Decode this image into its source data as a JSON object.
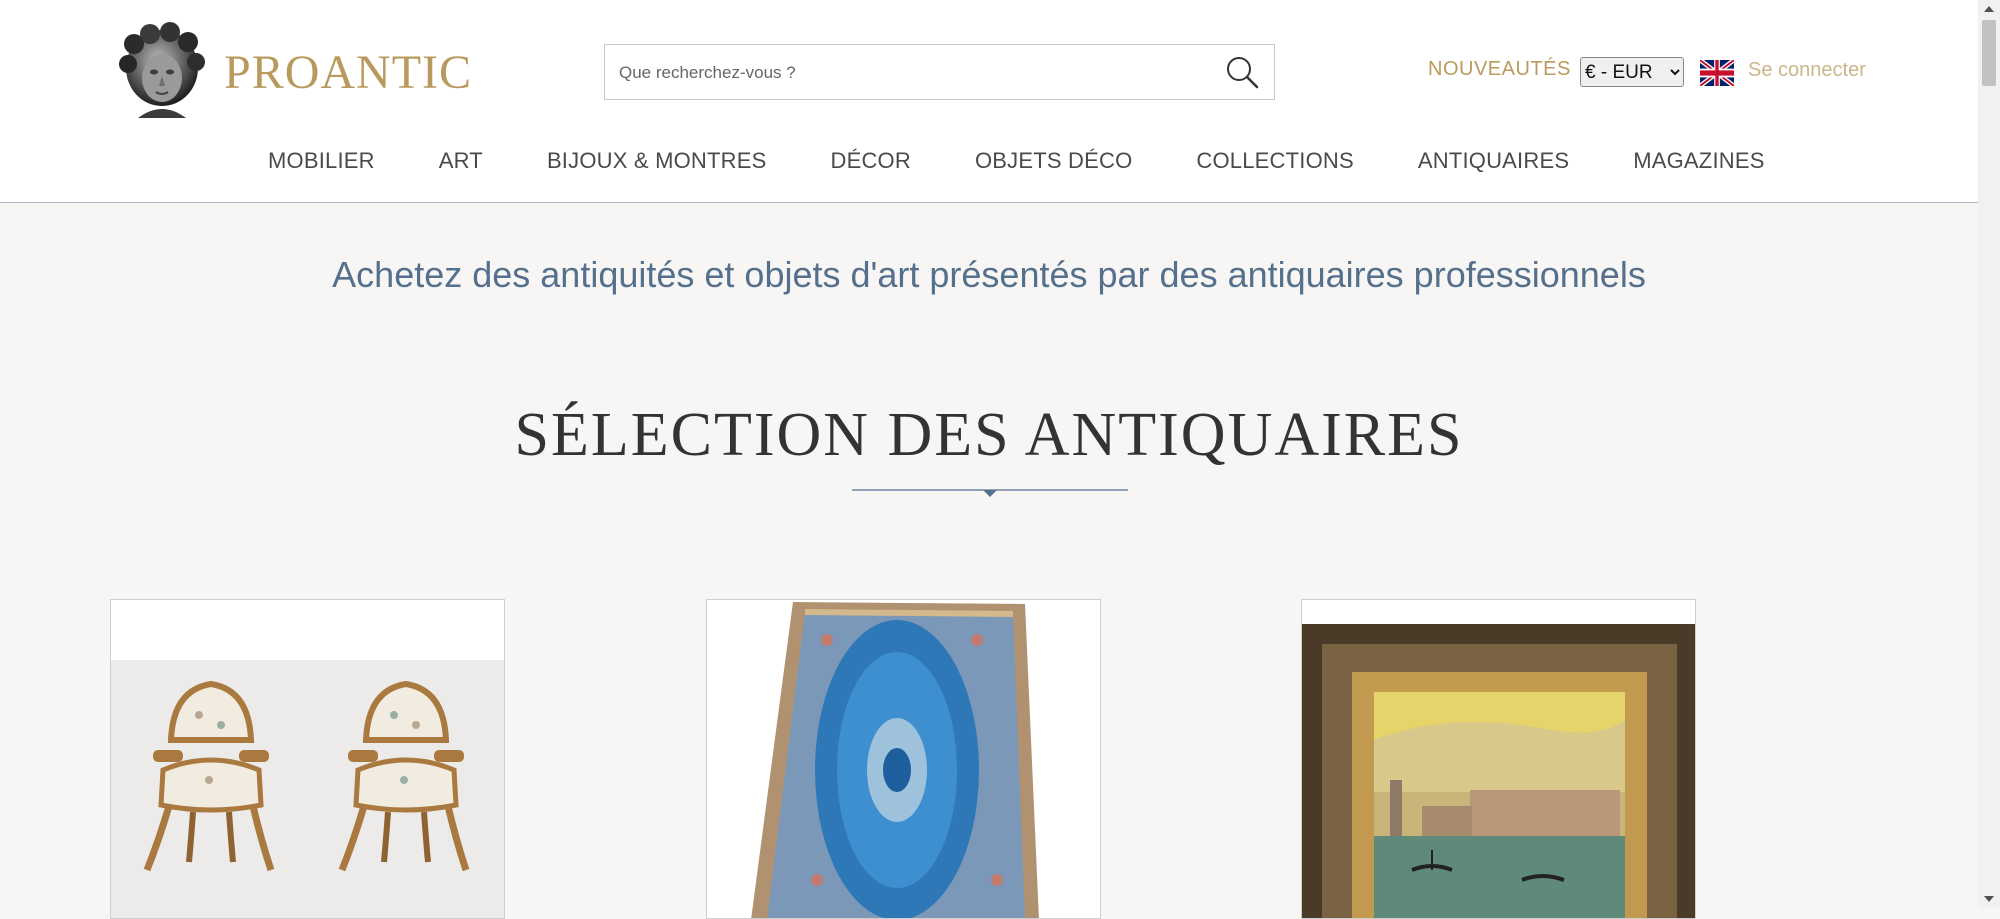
{
  "header": {
    "logo_text": "PROANTIC",
    "search_placeholder": "Que recherchez-vous ?",
    "new_link": "NOUVEAUTÉS",
    "currency_selected": "€ - EUR",
    "login": "Se connecter",
    "language_flag": "uk-flag-icon"
  },
  "nav": {
    "items": [
      "MOBILIER",
      "ART",
      "BIJOUX & MONTRES",
      "DÉCOR",
      "OBJETS DÉCO",
      "COLLECTIONS",
      "ANTIQUAIRES",
      "MAGAZINES"
    ]
  },
  "main": {
    "tagline": "Achetez des antiquités et objets d'art présentés par des antiquaires professionnels",
    "section_title": "SÉLECTION DES ANTIQUAIRES"
  },
  "colors": {
    "gold": "#b99a5e",
    "light_gold": "#cdb58a",
    "tagline_blue": "#55708c",
    "divider_blue": "#6e84a0",
    "background": "#f7f6f4"
  },
  "icons": {
    "search": "search-icon",
    "logo": "bust-logo-icon",
    "divider": "chevron-divider-icon"
  }
}
